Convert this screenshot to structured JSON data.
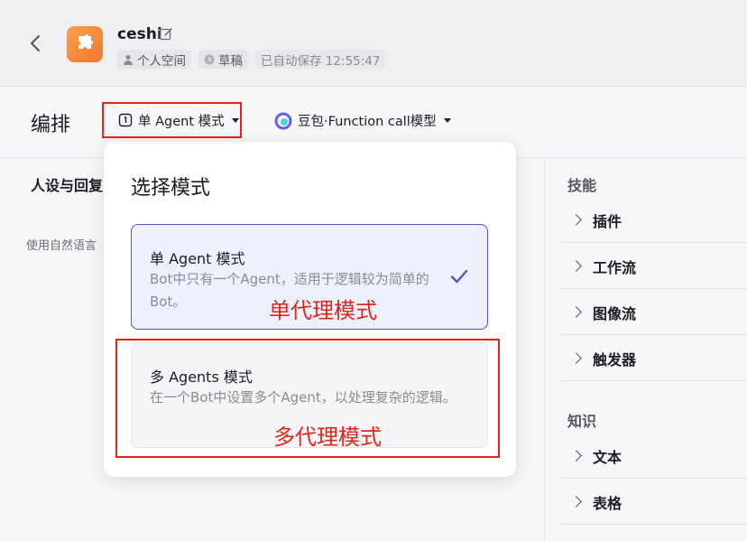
{
  "header": {
    "title": "ceshi",
    "workspace": "个人空间",
    "status": "草稿",
    "autosave": "已自动保存 12:55:47"
  },
  "toolbar": {
    "title": "编排",
    "mode_label": "单 Agent 模式",
    "model_label": "豆包·Function call模型"
  },
  "left_panel": {
    "title": "人设与回复",
    "desc": "使用自然语言"
  },
  "dropdown": {
    "title": "选择模式",
    "options": [
      {
        "title": "单 Agent 模式",
        "desc": "Bot中只有一个Agent，适用于逻辑较为简单的Bot。",
        "selected": true
      },
      {
        "title": "多 Agents 模式",
        "desc": "在一个Bot中设置多个Agent，以处理复杂的逻辑。",
        "selected": false
      }
    ]
  },
  "annotations": {
    "single": "单代理模式",
    "multi": "多代理模式"
  },
  "right_panel": {
    "skills_title": "技能",
    "skills": [
      "插件",
      "工作流",
      "图像流",
      "触发器"
    ],
    "knowledge_title": "知识",
    "knowledge": [
      "文本",
      "表格"
    ]
  },
  "colors": {
    "accent": "#4e55c9",
    "annotation_red": "#e0261b",
    "app_icon": "#f0782f"
  }
}
